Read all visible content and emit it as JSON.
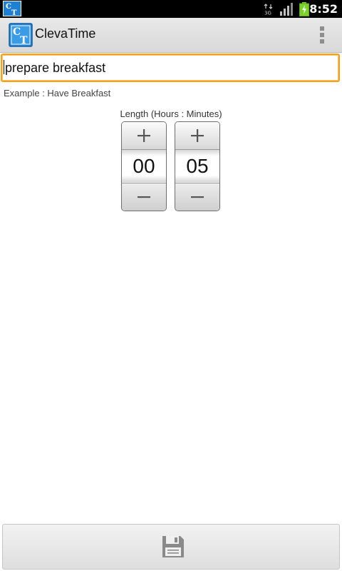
{
  "status_bar": {
    "time": "8:52",
    "data_indicator": "3G",
    "icons": [
      "app-notification-icon",
      "data-3g-icon",
      "signal-icon",
      "battery-icon"
    ]
  },
  "title_bar": {
    "app_name": "ClevaTime",
    "app_icon_text": "CT",
    "menu_icon": "overflow-menu-icon"
  },
  "task": {
    "value": "prepare breakfast",
    "hint": "Example : Have Breakfast"
  },
  "length": {
    "label": "Length (Hours : Minutes)",
    "hours": "00",
    "minutes": "05",
    "increment_symbol": "+",
    "decrement_symbol": "−"
  },
  "actions": {
    "save_icon": "save-icon"
  },
  "colors": {
    "focus_border": "#f5a21a",
    "app_icon_blue": "#2a86d6",
    "battery_green": "#7bd22b"
  }
}
